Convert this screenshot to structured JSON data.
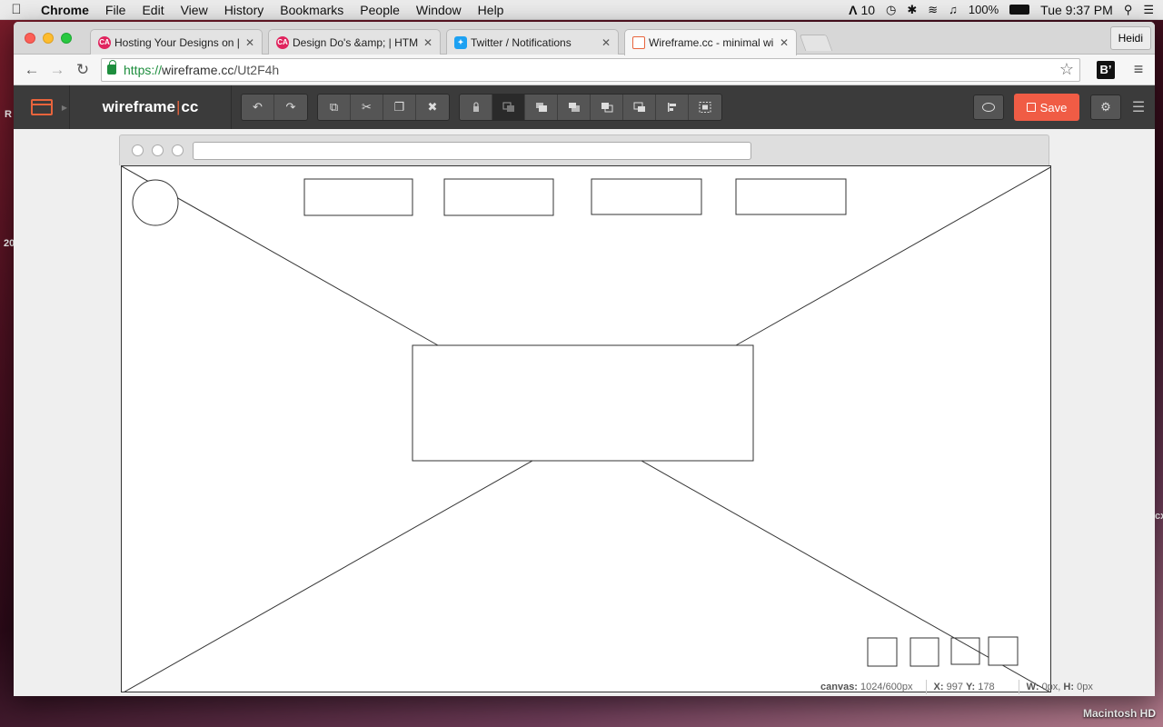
{
  "menubar": {
    "app": "Chrome",
    "items": [
      "File",
      "Edit",
      "View",
      "History",
      "Bookmarks",
      "People",
      "Window",
      "Help"
    ],
    "status": {
      "adobe": "10",
      "battery": "100%",
      "clock": "Tue 9:37 PM"
    }
  },
  "desktop": {
    "left_text_1": "R",
    "left_text_2": "20",
    "right_text": "cx",
    "drive_label": "Macintosh HD"
  },
  "browser": {
    "tabs": [
      {
        "label": "Hosting Your Designs on | ",
        "favicon": "ca-icon"
      },
      {
        "label": "Design Do's &amp; | HTML",
        "favicon": "ca-icon"
      },
      {
        "label": "Twitter / Notifications",
        "favicon": "twitter-icon"
      },
      {
        "label": "Wireframe.cc - minimal wir",
        "favicon": "wireframe-icon"
      }
    ],
    "profile": "Heidi",
    "url_scheme": "https://",
    "url_host": "wireframe.cc",
    "url_path": "/Ut2F4h"
  },
  "app": {
    "brand_left": "wireframe",
    "brand_right": "cc",
    "save_label": "Save"
  },
  "status": {
    "canvas_label": "canvas:",
    "canvas_value": "1024/600px",
    "x_label": "X:",
    "x_value": "997",
    "y_label": "Y:",
    "y_value": "178",
    "w_label": "W:",
    "w_value": "0px,",
    "h_label": "H:",
    "h_value": "0px"
  }
}
